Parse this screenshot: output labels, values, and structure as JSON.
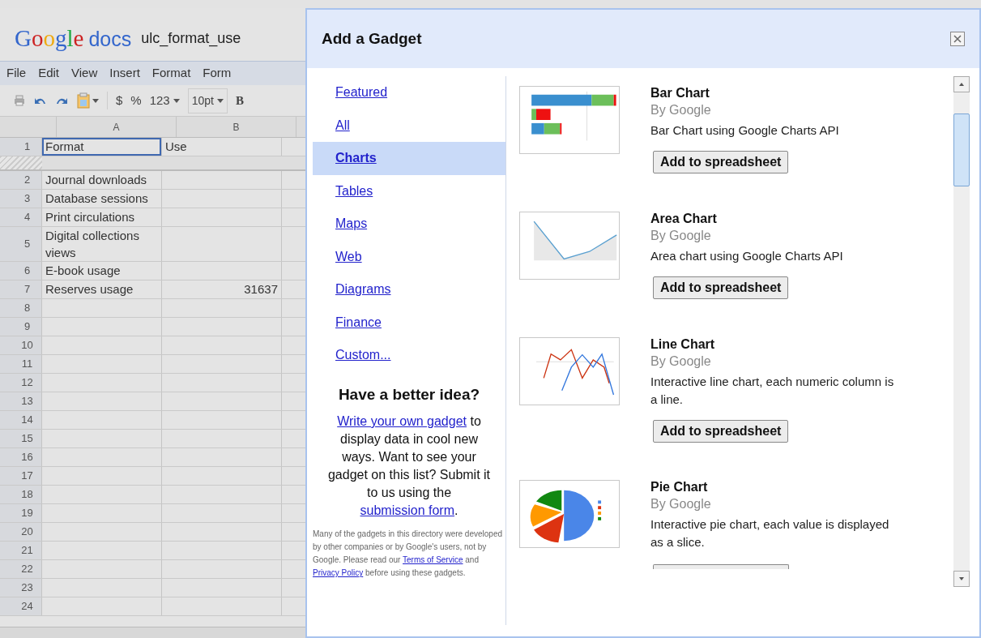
{
  "sheet": {
    "logo": "Google",
    "product": "docs",
    "title": "ulc_format_use",
    "menu": [
      "File",
      "Edit",
      "View",
      "Insert",
      "Format",
      "Form"
    ],
    "toolbar": {
      "currency": "$",
      "percent": "%",
      "number_format": "123",
      "font_size": "10pt",
      "bold": "B"
    },
    "columns": [
      "A",
      "B"
    ],
    "rows": [
      {
        "number": "1",
        "cells": [
          {
            "text": "Format",
            "kind": "text",
            "selected": true
          },
          {
            "text": "Use",
            "kind": "text",
            "selected": false
          }
        ]
      },
      {
        "number": "2",
        "cells": [
          {
            "text": "Journal downloads",
            "kind": "text",
            "selected": false
          }
        ]
      },
      {
        "number": "3",
        "cells": [
          {
            "text": "Database sessions",
            "kind": "text",
            "selected": false
          }
        ]
      },
      {
        "number": "4",
        "cells": [
          {
            "text": "Print circulations",
            "kind": "text",
            "selected": false
          }
        ]
      },
      {
        "number": "5",
        "cells": [
          {
            "text": "Digital collections views",
            "kind": "text",
            "selected": false
          }
        ]
      },
      {
        "number": "6",
        "cells": [
          {
            "text": "E-book usage",
            "kind": "text",
            "selected": false
          }
        ]
      },
      {
        "number": "7",
        "cells": [
          {
            "text": "Reserves usage",
            "kind": "text",
            "selected": false
          },
          {
            "text": "31637",
            "kind": "number",
            "selected": false
          }
        ]
      },
      {
        "number": "8"
      },
      {
        "number": "9"
      },
      {
        "number": "10"
      },
      {
        "number": "11"
      },
      {
        "number": "12"
      },
      {
        "number": "13"
      },
      {
        "number": "14"
      },
      {
        "number": "15"
      },
      {
        "number": "16"
      },
      {
        "number": "17"
      },
      {
        "number": "18"
      },
      {
        "number": "19"
      },
      {
        "number": "20"
      },
      {
        "number": "21"
      },
      {
        "number": "22"
      },
      {
        "number": "23"
      },
      {
        "number": "24"
      }
    ]
  },
  "dialog": {
    "title": "Add a Gadget",
    "nav": [
      {
        "label": "Featured",
        "selected": false
      },
      {
        "label": "All",
        "selected": false
      },
      {
        "label": "Charts",
        "selected": true
      },
      {
        "label": "Tables",
        "selected": false
      },
      {
        "label": "Maps",
        "selected": false
      },
      {
        "label": "Web",
        "selected": false
      },
      {
        "label": "Diagrams",
        "selected": false
      },
      {
        "label": "Finance",
        "selected": false
      },
      {
        "label": "Custom...",
        "selected": false
      }
    ],
    "idea_heading": "Have a better idea?",
    "idea_text": [
      {
        "kind": "link",
        "text": "Write your own gadget"
      },
      {
        "kind": "text",
        "text": " to display data in cool new ways. Want to see your gadget on this list? Submit it to us using the "
      },
      {
        "kind": "link",
        "text": "submission form"
      },
      {
        "kind": "text",
        "text": "."
      }
    ],
    "disclaimer": [
      {
        "kind": "text",
        "text": "Many of the gadgets in this directory were developed by other companies or by Google's users, not by Google. Please read our "
      },
      {
        "kind": "link",
        "text": "Terms of Service"
      },
      {
        "kind": "text",
        "text": " and "
      },
      {
        "kind": "link",
        "text": "Privacy Policy"
      },
      {
        "kind": "text",
        "text": " before using these gadgets."
      }
    ],
    "gadgets": [
      {
        "kind": "bar",
        "title": "Bar Chart",
        "author": "By Google",
        "description": "Bar Chart using Google Charts API",
        "button": "Add to spreadsheet"
      },
      {
        "kind": "area",
        "title": "Area Chart",
        "author": "By Google",
        "description": "Area chart using Google Charts API",
        "button": "Add to spreadsheet"
      },
      {
        "kind": "line",
        "title": "Line Chart",
        "author": "By Google",
        "description": "Interactive line chart, each numeric column is a line.",
        "button": "Add to spreadsheet"
      },
      {
        "kind": "pie",
        "title": "Pie Chart",
        "author": "By Google",
        "description": "Interactive pie chart, each value is displayed as a slice.",
        "button_cut": true
      }
    ]
  }
}
